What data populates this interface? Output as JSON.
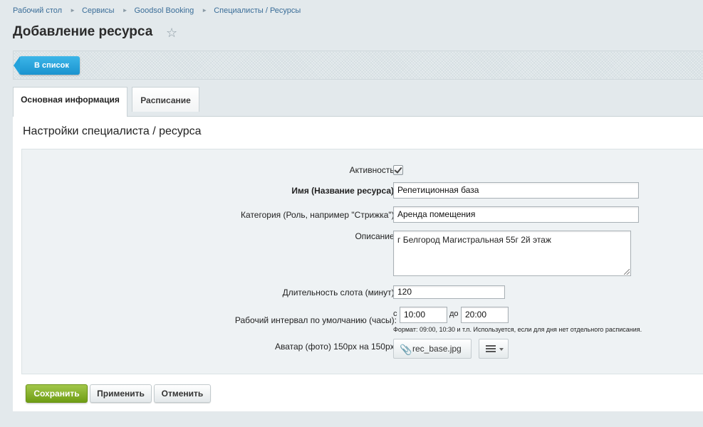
{
  "breadcrumb": {
    "items": [
      "Рабочий стол",
      "Сервисы",
      "Goodsol Booking",
      "Специалисты / Ресурсы"
    ],
    "separator": "►"
  },
  "header": {
    "title": "Добавление ресурса",
    "star_icon": "star-icon",
    "star_glyph": "☆"
  },
  "toolbar": {
    "back_label": "В список"
  },
  "tabs": [
    {
      "label": "Основная информация",
      "active": true
    },
    {
      "label": "Расписание",
      "active": false
    }
  ],
  "section": {
    "title": "Настройки специалиста / ресурса"
  },
  "form": {
    "active": {
      "label": "Активность:",
      "checked": true
    },
    "name": {
      "label": "Имя (Название ресурса):",
      "value": "Репетиционная база"
    },
    "category": {
      "label": "Категория (Роль, например \"Стрижка\"):",
      "value": "Аренда помещения"
    },
    "description": {
      "label": "Описание:",
      "value": "г Белгород Магистральная 55г 2й этаж"
    },
    "slot": {
      "label": "Длительность слота (минут):",
      "value": "120"
    },
    "interval": {
      "label": "Рабочий интервал по умолчанию (часы):",
      "from_label": "с",
      "from_value": "10:00",
      "to_label": "до",
      "to_value": "20:00",
      "hint": "Формат: 09:00, 10:30 и т.п. Используется, если для дня нет отдельного расписания."
    },
    "avatar": {
      "label": "Аватар (фото) 150px на 150px:",
      "file_name": "rec_base.jpg",
      "clip_glyph": "📎"
    }
  },
  "footer": {
    "save_label": "Сохранить",
    "apply_label": "Применить",
    "cancel_label": "Отменить"
  },
  "colors": {
    "accent_blue": "#1a93cf",
    "save_green": "#6f9d14",
    "background": "#e3e9ec"
  }
}
